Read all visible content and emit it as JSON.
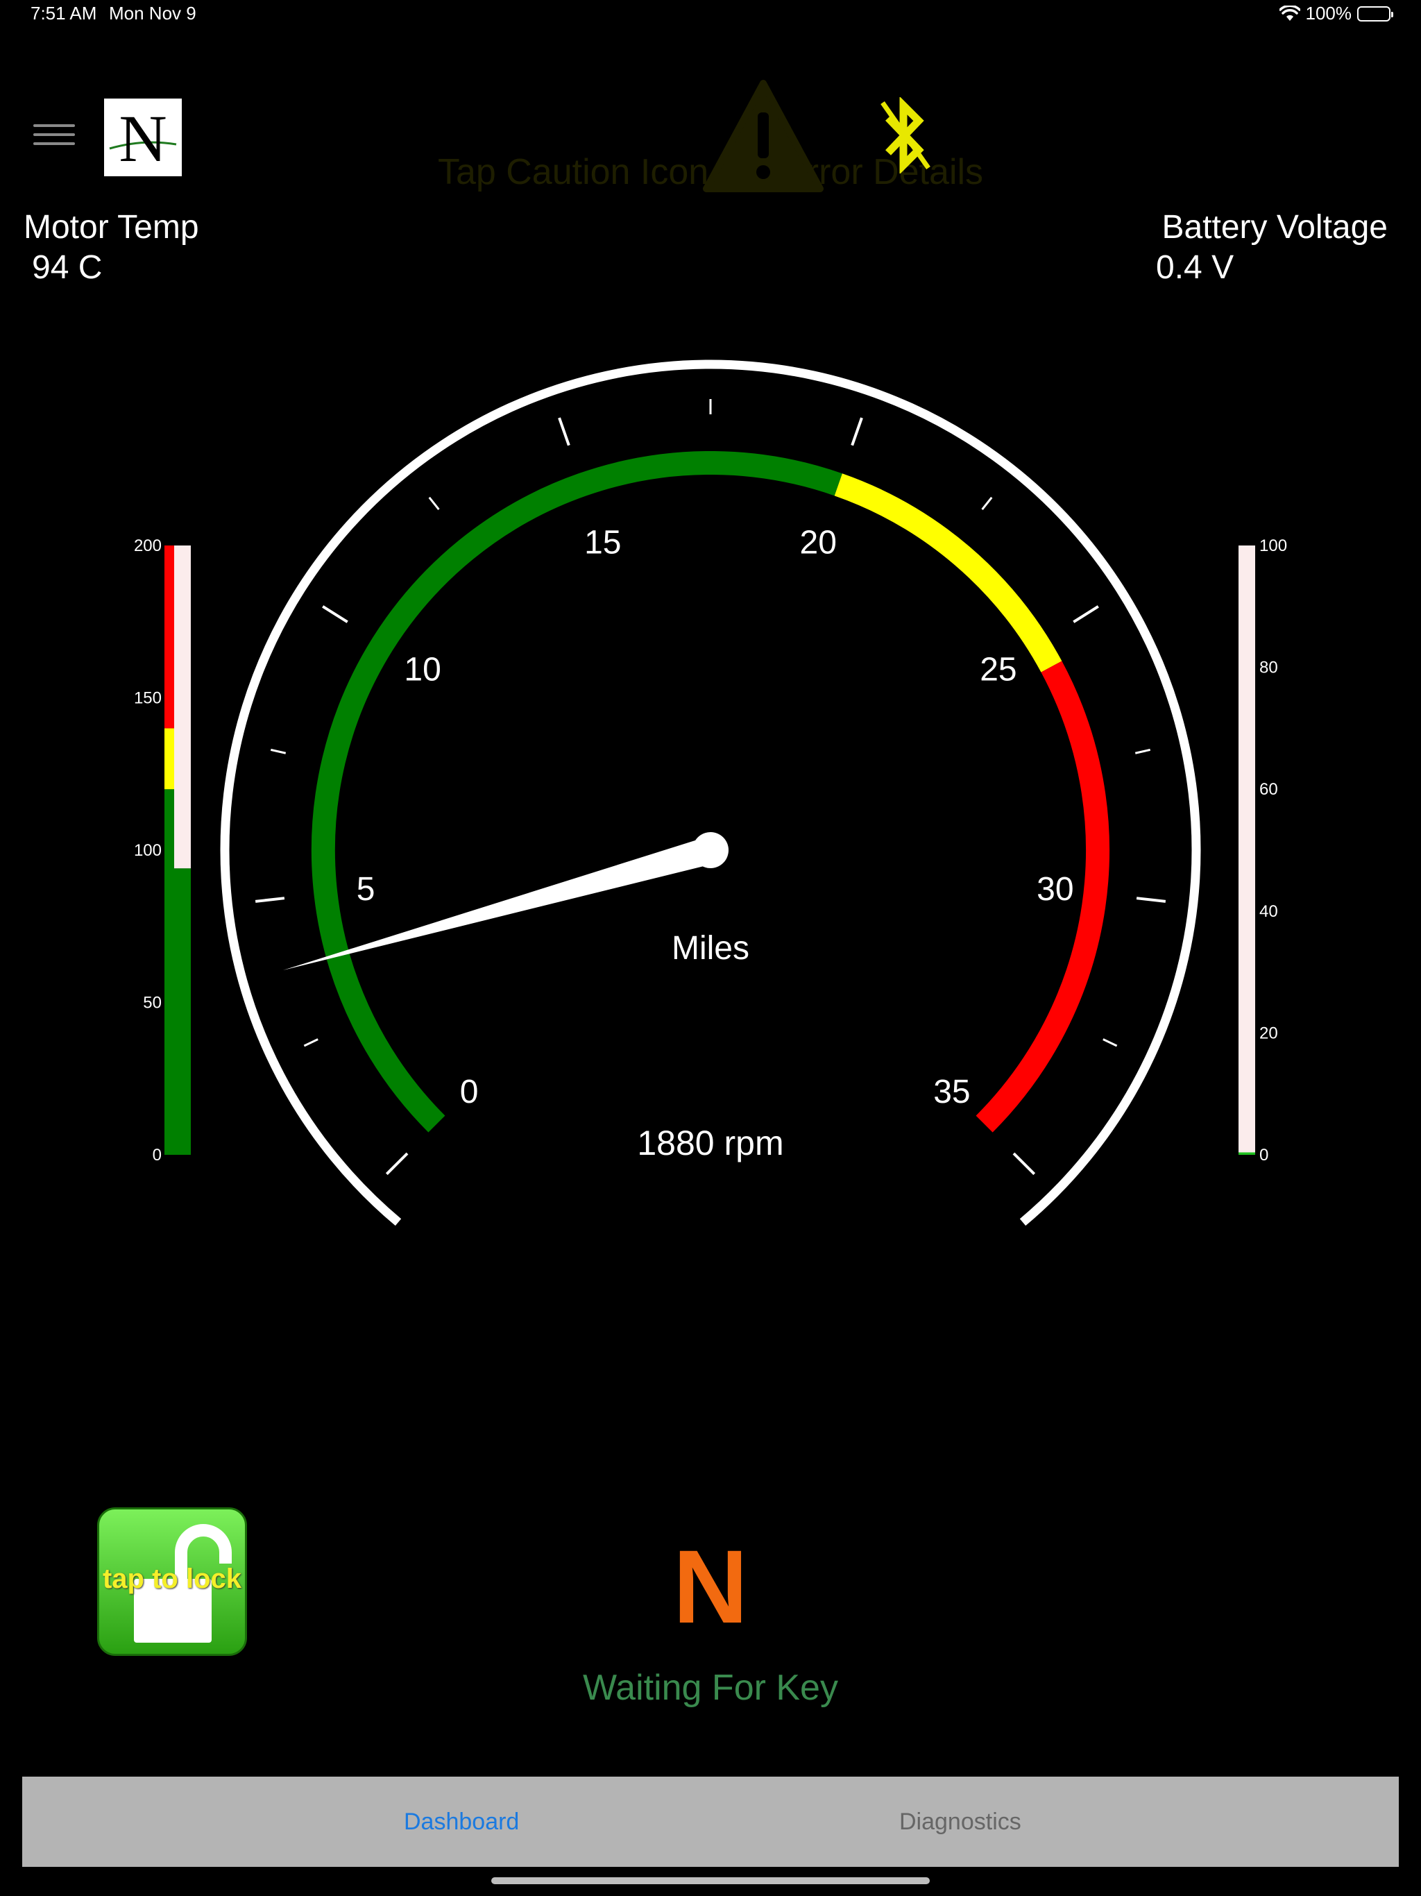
{
  "status_bar": {
    "time": "7:51 AM",
    "date": "Mon Nov 9",
    "battery": "100%"
  },
  "header": {
    "caution_hint": "Tap Caution Icon For Error Details"
  },
  "readouts": {
    "motor_temp_label": "Motor Temp",
    "motor_temp_value": "94 C",
    "battery_voltage_label": "Battery Voltage",
    "battery_voltage_value": "0.4 V"
  },
  "speedometer": {
    "unit_label": "Miles",
    "rpm_text": "1880 rpm",
    "min": 0,
    "max": 35,
    "value": 3.8,
    "tick_labels": [
      "0",
      "5",
      "10",
      "15",
      "20",
      "25",
      "30",
      "35"
    ],
    "zones": [
      {
        "from": 0,
        "to": 20,
        "color": "#008000"
      },
      {
        "from": 20,
        "to": 25.5,
        "color": "#ffff00"
      },
      {
        "from": 25.5,
        "to": 35,
        "color": "#ff0000"
      }
    ]
  },
  "temp_bar": {
    "ticks": [
      "0",
      "50",
      "100",
      "150",
      "200"
    ],
    "max": 200,
    "value": 94,
    "zones": [
      {
        "from": 0,
        "to": 120,
        "color": "#008000"
      },
      {
        "from": 120,
        "to": 140,
        "color": "#ffff00"
      },
      {
        "from": 140,
        "to": 200,
        "color": "#ff0000"
      }
    ]
  },
  "voltage_bar": {
    "ticks": [
      "0",
      "20",
      "40",
      "60",
      "80",
      "100"
    ],
    "max": 100,
    "value": 0.4
  },
  "lock": {
    "label": "tap to lock"
  },
  "drive": {
    "gear": "N",
    "status": "Waiting For Key"
  },
  "tabs": {
    "dashboard": "Dashboard",
    "diagnostics": "Diagnostics"
  },
  "colors": {
    "accent": "#1b7ae0",
    "gear": "#f26a10",
    "status_green": "#3a8a4e"
  }
}
